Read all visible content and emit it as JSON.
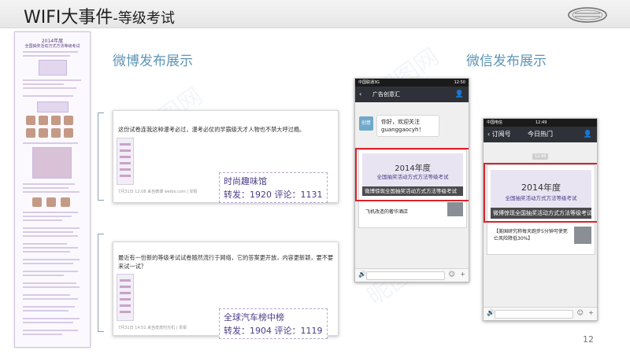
{
  "header": {
    "title": "WIFI大事件",
    "subtitle": "-等级考试"
  },
  "sections": {
    "weibo": "微博发布展示",
    "wechat": "微信发布展示"
  },
  "long_page": {
    "title": "2014年度",
    "subtitle": "全国抽奖活动方式方法等级考试"
  },
  "weibo_posts": [
    {
      "text": "这份试卷连我这种漫考必过，漫考必仗的学霸级天才人物也不禁大呼过瘾。",
      "footer": "7月31日 12:08 来自微博 weibo.com | 举报",
      "source_name": "时尚趣味馆",
      "reposts_label": "转发：1920",
      "comments_label": "评论：1131"
    },
    {
      "text": "最近有一份新的等级考试试卷随然流行于网络，它的答案更开放，内容更新颖，要不要来试一试？",
      "footer": "7月31日 14:51 来自皮皮时光机 | 举报",
      "source_name": "全球汽车榜中榜",
      "reposts_label": "转发：1904",
      "comments_label": "评论：1119"
    }
  ],
  "wechat_left": {
    "carrier": "中国联通3G",
    "clock": "12:50",
    "chat_title": "广告创意汇",
    "avatar_text": "创意",
    "greeting": "你好，欢迎关注",
    "account_id": "guanggaocyh！",
    "banner_year": "2014年度",
    "banner_subtitle": "全国抽奖活动方式方法等级考试",
    "banner_caption": "微博惊现全国抽奖活动方式方法等级考试",
    "next_item": "飞机改造的奢华酒店"
  },
  "wechat_right": {
    "carrier": "中国电信",
    "clock": "12:49",
    "back_label": "订阅号",
    "chat_title": "今日热门",
    "time_label": "12:48",
    "banner_year": "2014年度",
    "banner_subtitle": "全国抽奖活动方式方法等级考试",
    "banner_caption": "微博惊现全国抽奖活动方式方法等级考试",
    "next_item": "【美国研究称每天跑步5分钟可使死亡风险降低30%】"
  },
  "page_number": "12",
  "watermark": "昵图网",
  "colors": {
    "accent": "#5e95b5",
    "highlight": "#d9232a",
    "stat_text": "#4b3b86"
  }
}
